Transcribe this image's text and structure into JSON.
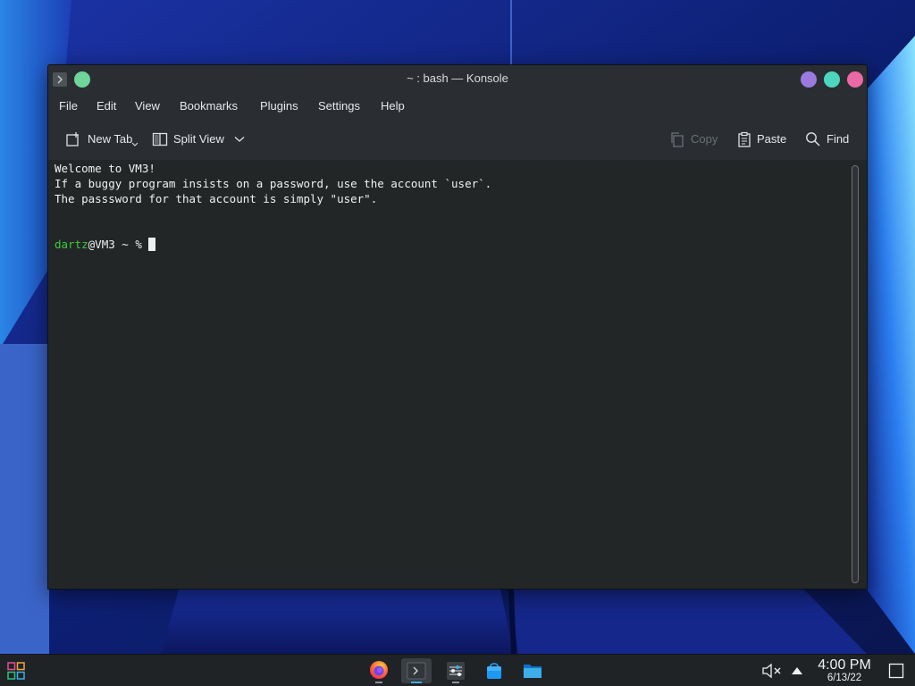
{
  "window": {
    "title": "~ : bash — Konsole",
    "title_colors": {
      "pin": "#6fd59a",
      "minimize": "#9b7ae0",
      "maximize": "#4cd6c0",
      "close": "#ea6aa6"
    }
  },
  "menubar": {
    "items": [
      "File",
      "Edit",
      "View",
      "Bookmarks",
      "Plugins",
      "Settings",
      "Help"
    ]
  },
  "toolbar": {
    "new_tab_label": "New Tab",
    "split_view_label": "Split View",
    "copy_label": "Copy",
    "paste_label": "Paste",
    "find_label": "Find",
    "icons": [
      "new-tab-icon",
      "split-view-icon",
      "chevron-down-icon",
      "copy-icon",
      "paste-icon",
      "search-icon"
    ]
  },
  "terminal": {
    "lines": [
      "Welcome to VM3!",
      "If a buggy program insists on a password, use the account `user`.",
      "The passsword for that account is simply \"user\"."
    ],
    "prompt": {
      "user": "dartz",
      "host_suffix": "@VM3 ~ % "
    },
    "colors": {
      "background": "#232627",
      "foreground": "#eff0f1",
      "user": "#3ec93e"
    }
  },
  "taskbar": {
    "apps": [
      "application-launcher-icon",
      "firefox-icon",
      "konsole-icon",
      "system-settings-icon",
      "discover-store-icon",
      "dolphin-folder-icon"
    ],
    "tray": [
      "volume-muted-icon",
      "tray-expand-icon"
    ],
    "time": "4:00 PM",
    "date": "6/13/22",
    "show_desktop_icon": "show-desktop-icon"
  }
}
